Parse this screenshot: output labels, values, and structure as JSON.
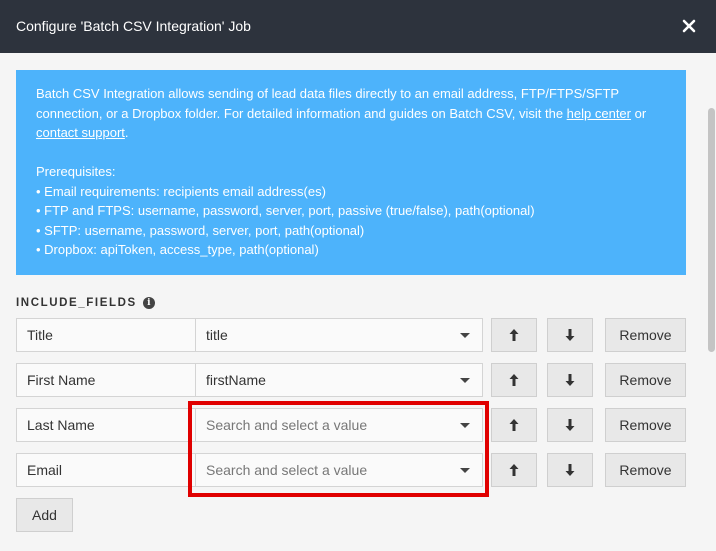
{
  "dialog": {
    "title": "Configure 'Batch CSV Integration' Job",
    "close_icon": "close-icon"
  },
  "info": {
    "line1_pre": "Batch CSV Integration allows sending of lead data files directly to an email address, FTP/FTPS/SFTP connection, or a Dropbox folder. For detailed information and guides on Batch CSV, visit the ",
    "help_link": "help center",
    "line1_mid": " or ",
    "contact_link": "contact support",
    "line1_end": ".",
    "prereq_title": "Prerequisites:",
    "prereqs": [
      "• Email requirements: recipients email address(es)",
      "• FTP and FTPS: username, password, server, port, passive (true/false), path(optional)",
      "• SFTP: username, password, server, port, path(optional)",
      "• Dropbox: apiToken, access_type, path(optional)"
    ]
  },
  "include_fields": {
    "label": "INCLUDE_FIELDS",
    "info_icon": "i",
    "rows": [
      {
        "name": "Title",
        "value": "title",
        "placeholder": false
      },
      {
        "name": "First Name",
        "value": "firstName",
        "placeholder": false
      },
      {
        "name": "Last Name",
        "value": "Search and select a value",
        "placeholder": true
      },
      {
        "name": "Email",
        "value": "Search and select a value",
        "placeholder": true
      }
    ],
    "remove_label": "Remove",
    "add_label": "Add"
  },
  "colors": {
    "titlebar": "#2d333d",
    "info_bg": "#4db3fb",
    "highlight": "#e00000"
  }
}
